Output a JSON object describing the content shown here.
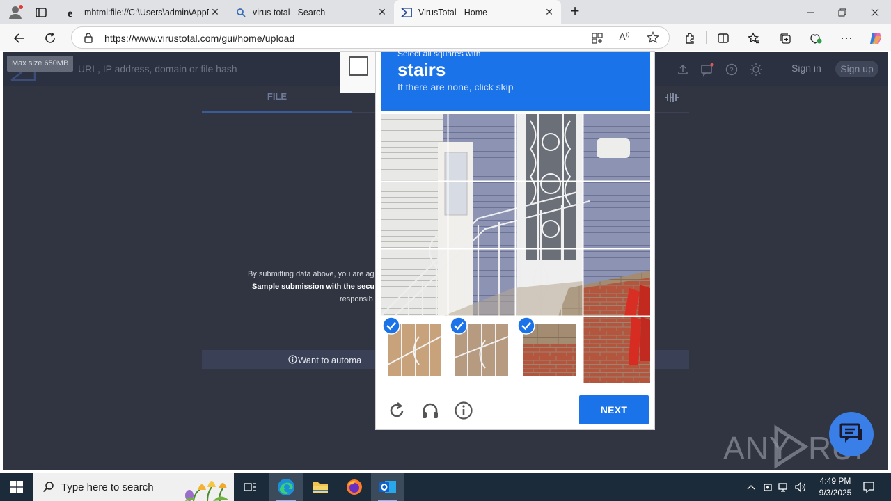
{
  "browser": {
    "tabs": [
      {
        "title": "mhtml:file://C:\\Users\\admin\\AppD",
        "icon": "ie-e-icon"
      },
      {
        "title": "virus total - Search",
        "icon": "search-icon"
      },
      {
        "title": "VirusTotal - Home",
        "icon": "virustotal-icon"
      }
    ],
    "url": "https://www.virustotal.com/gui/home/upload"
  },
  "virustotal": {
    "max_size_tooltip": "Max size 650MB",
    "search_placeholder": "URL, IP address, domain or file hash",
    "sign_in": "Sign in",
    "sign_up": "Sign up",
    "file_tab": "FILE",
    "disclaimer_line1": "By submitting data above, you are ag",
    "disclaimer_line2": "Sample submission with the secu",
    "disclaimer_line3": "responsib",
    "automate": "Want to automa"
  },
  "captcha": {
    "instruction": "Select all squares with",
    "target": "stairs",
    "hint": "If there are none, click skip",
    "next_button": "NEXT",
    "accent_color": "#1a73e8",
    "selected_tiles": [
      6,
      7,
      8
    ]
  },
  "watermark": {
    "text": "ANY RUN"
  },
  "taskbar": {
    "search_placeholder": "Type here to search",
    "time": "4:49 PM",
    "date": "9/3/2025"
  }
}
